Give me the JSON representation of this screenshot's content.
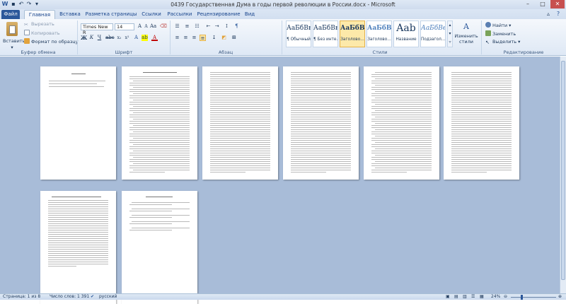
{
  "window": {
    "title": "0439 Государственная Дума  в годы первой революции в России.docx  -  Microsoft Word"
  },
  "tabs": [
    "Файл",
    "Главная",
    "Вставка",
    "Разметка страницы",
    "Ссылки",
    "Рассылки",
    "Рецензирование",
    "Вид"
  ],
  "ribbon": {
    "clipboard": {
      "label": "Буфер обмена",
      "paste": "Вставить",
      "cut": "Вырезать",
      "copy": "Копировать",
      "format_painter": "Формат по образцу"
    },
    "font": {
      "label": "Шрифт",
      "font_name": "Times New R",
      "font_size": "14"
    },
    "paragraph": {
      "label": "Абзац"
    },
    "styles": {
      "label": "Стили",
      "items": [
        {
          "sample": "АаБбВвГ",
          "name": "¶ Обычный"
        },
        {
          "sample": "АаБбВвГ",
          "name": "¶ Без инте..."
        },
        {
          "sample": "АаБбВ",
          "name": "Заголово..."
        },
        {
          "sample": "АаБбВв",
          "name": "Заголово..."
        },
        {
          "sample": "Aab",
          "name": "Название"
        },
        {
          "sample": "АаБбВв",
          "name": "Подзагол..."
        }
      ],
      "change_styles": "Изменить стили"
    },
    "editing": {
      "label": "Редактирование",
      "find": "Найти",
      "replace": "Заменить",
      "select": "Выделить"
    }
  },
  "status": {
    "page": "Страница: 1 из 8",
    "words": "Число слов: 1 391",
    "language": "русский",
    "zoom": "24%"
  },
  "theme": {
    "file_tab": "#2b579a",
    "canvas": "#a8bcd8",
    "selected_style": "#fde9a9"
  }
}
